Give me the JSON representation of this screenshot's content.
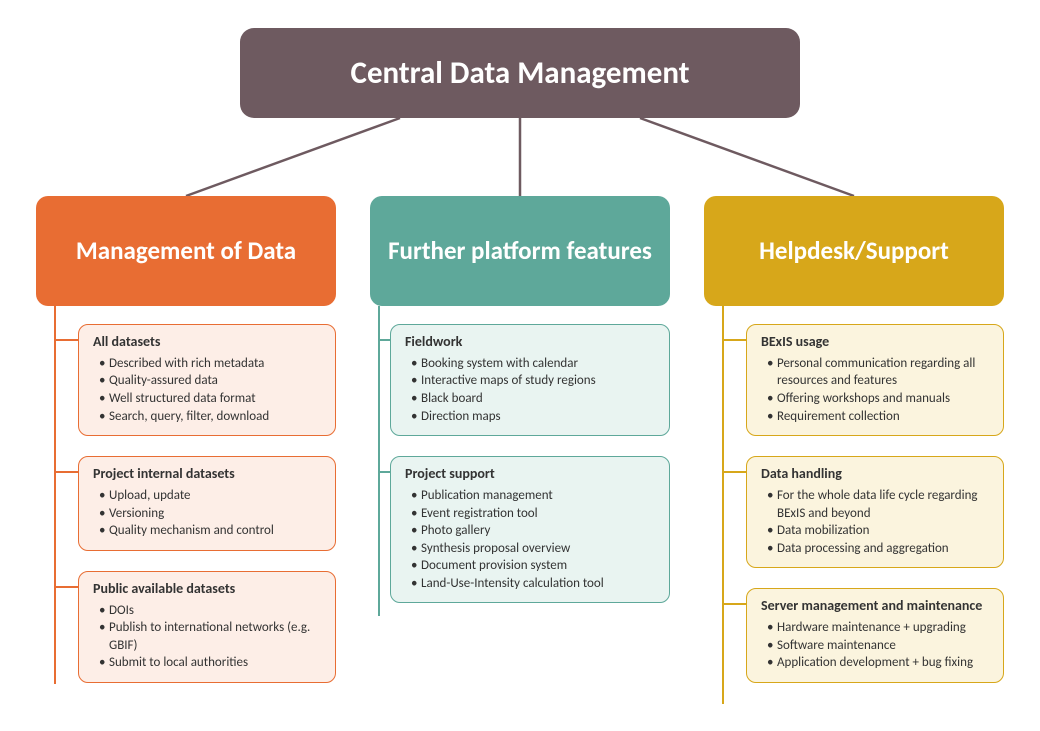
{
  "root": {
    "title": "Central Data Management"
  },
  "columns": [
    {
      "title": "Management of Data",
      "cards": [
        {
          "title": "All datasets",
          "items": [
            "Described with rich metadata",
            "Quality-assured data",
            "Well structured data format",
            "Search, query, filter, download"
          ]
        },
        {
          "title": "Project internal datasets",
          "items": [
            "Upload, update",
            "Versioning",
            "Quality mechanism and control"
          ]
        },
        {
          "title": "Public available datasets",
          "items": [
            "DOIs",
            "Publish to international networks (e.g. GBIF)",
            "Submit to local authorities"
          ]
        }
      ]
    },
    {
      "title": "Further platform features",
      "cards": [
        {
          "title": "Fieldwork",
          "items": [
            "Booking system with calendar",
            "Interactive maps of study regions",
            "Black board",
            "Direction maps"
          ]
        },
        {
          "title": "Project support",
          "items": [
            "Publication management",
            "Event registration tool",
            "Photo gallery",
            "Synthesis proposal overview",
            "Document provision system",
            "Land-Use-Intensity calculation tool"
          ]
        }
      ]
    },
    {
      "title": "Helpdesk/Support",
      "cards": [
        {
          "title": "BExIS usage",
          "items": [
            "Personal communication regarding all resources and features",
            "Offering workshops and manuals",
            "Requirement collection"
          ]
        },
        {
          "title": "Data handling",
          "items": [
            "For the whole data life cycle regarding BExIS and beyond",
            "Data mobilization",
            "Data processing and aggregation"
          ]
        },
        {
          "title": "Server management and maintenance",
          "items": [
            "Hardware maintenance + upgrading",
            "Software maintenance",
            "Application development + bug fixing"
          ]
        }
      ]
    }
  ]
}
